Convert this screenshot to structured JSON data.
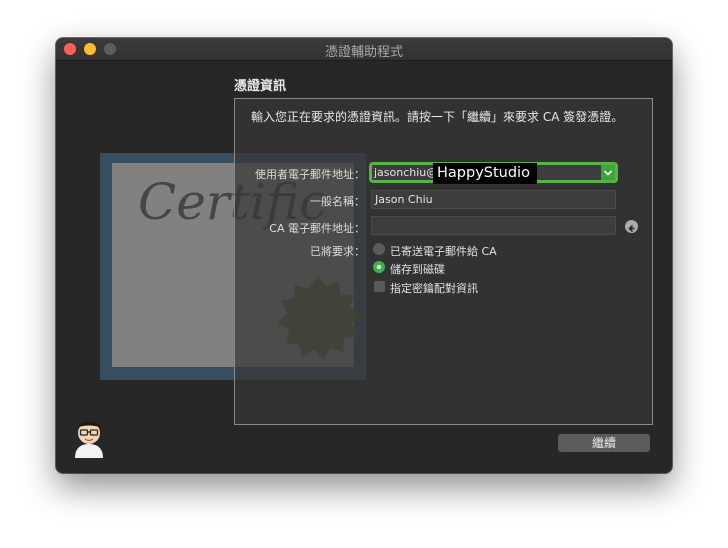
{
  "window": {
    "title": "憑證輔助程式"
  },
  "section": {
    "title": "憑證資訊"
  },
  "intro": "輸入您正在要求的憑證資訊。請按一下「繼續」來要求 CA 簽發憑證。",
  "certificate": {
    "script_word": "Certific"
  },
  "form": {
    "user_email_label": "使用者電子郵件地址：",
    "user_email_value": "jasonchiu@",
    "user_email_overlay": "HappyStudio",
    "common_name_label": "一般名稱：",
    "common_name_value": "Jason Chiu",
    "ca_email_label": "CA 電子郵件地址：",
    "ca_email_value": "",
    "request_label": "已將要求：",
    "options": [
      "已寄送電子郵件給 CA",
      "儲存到磁碟"
    ],
    "selected_option": 1,
    "checkbox_label": "指定密鑰配對資訊",
    "checkbox_checked": false
  },
  "buttons": {
    "continue": "繼續"
  },
  "colors": {
    "accent": "#3bb34a",
    "window_bg": "#272727",
    "panel_border": "#8a8a8a"
  }
}
